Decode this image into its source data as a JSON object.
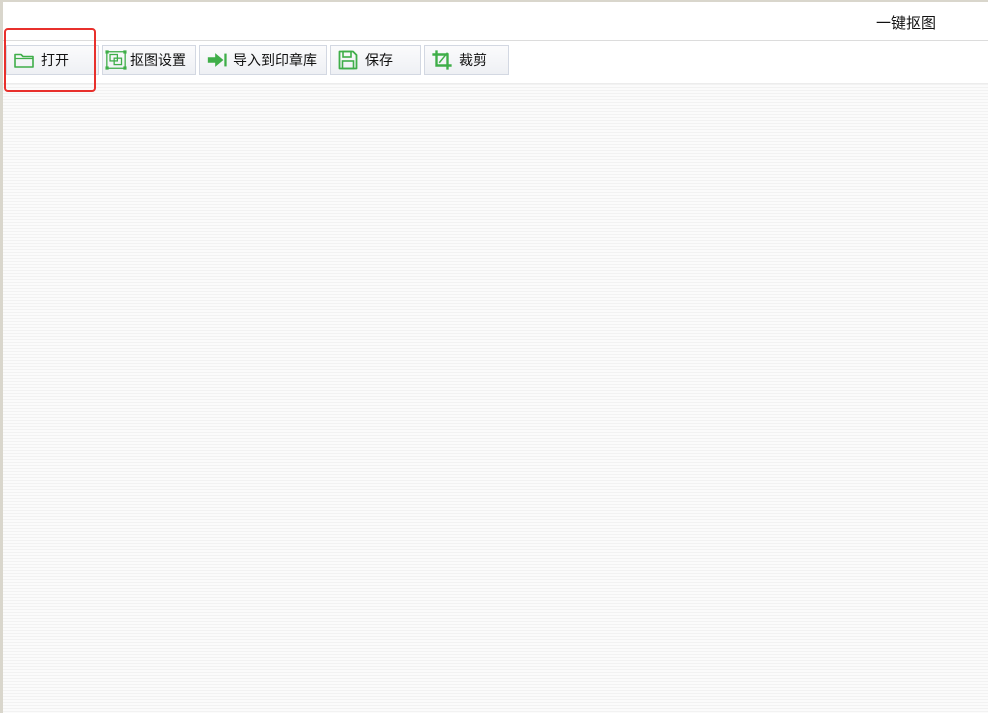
{
  "window": {
    "title": "一键抠图"
  },
  "toolbar": {
    "open": {
      "label": "打开",
      "icon": "folder-icon"
    },
    "cutout_settings": {
      "label": "抠图设置",
      "icon": "cutout-frame-icon"
    },
    "import_seal": {
      "label": "导入到印章库",
      "icon": "import-arrow-icon"
    },
    "save": {
      "label": "保存",
      "icon": "floppy-disk-icon"
    },
    "crop": {
      "label": "裁剪",
      "icon": "crop-icon"
    }
  },
  "colors": {
    "icon_green": "#3fae49",
    "highlight_red": "#e8302c"
  }
}
